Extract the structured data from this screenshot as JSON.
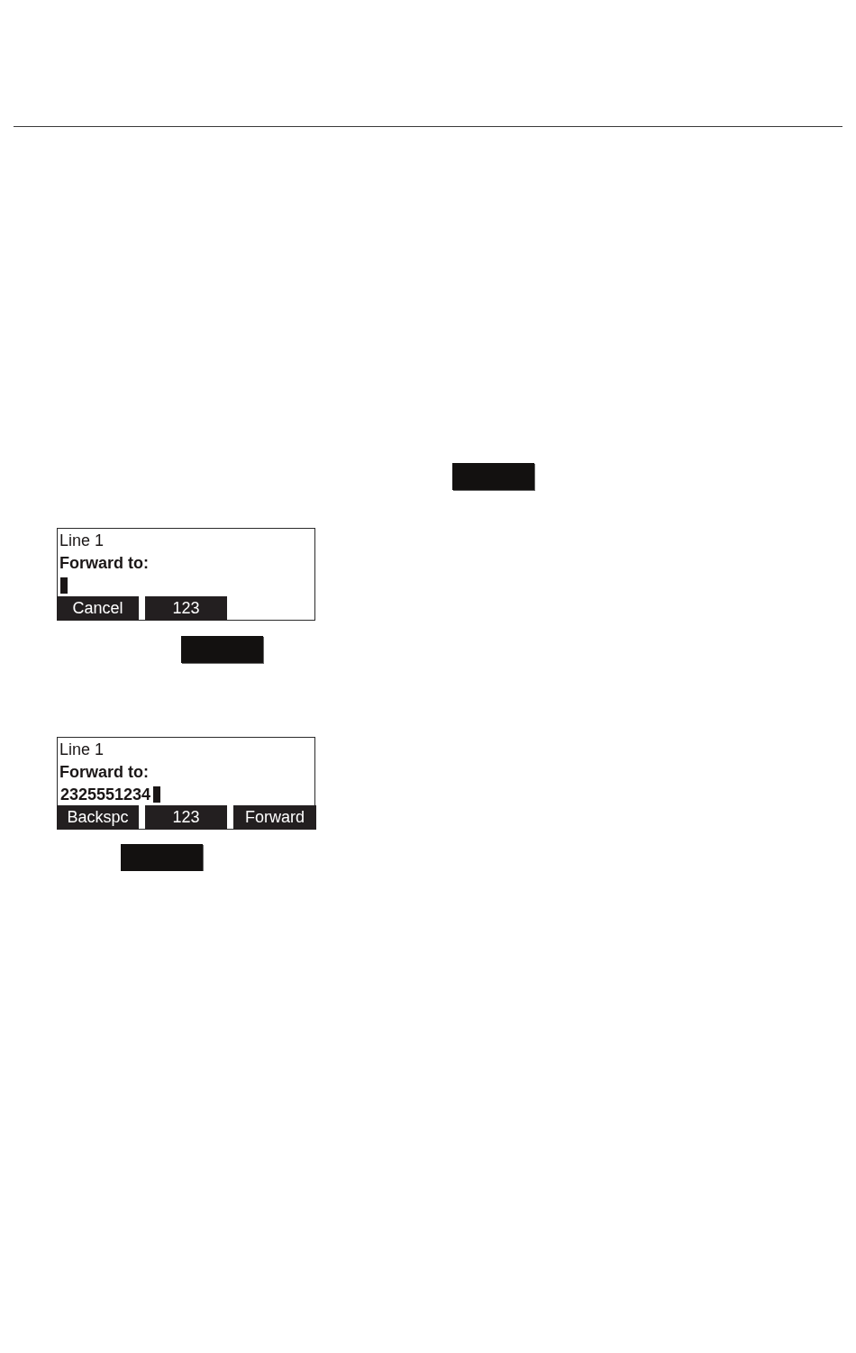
{
  "screens": [
    {
      "line": "Line 1",
      "prompt": "Forward to:",
      "entry": {
        "cursor": true
      },
      "softkeys": [
        "Cancel",
        "123"
      ]
    },
    {
      "line": "Line 1",
      "prompt": "Forward to:",
      "entry": {
        "value": "2325551234",
        "cursor": true
      },
      "softkeys": [
        "Backspc",
        "123",
        "Forward"
      ]
    }
  ]
}
